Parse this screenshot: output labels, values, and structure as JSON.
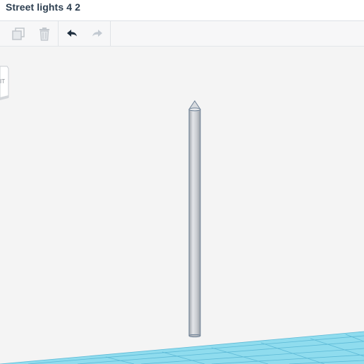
{
  "app": {
    "title": "Street lights 4 2"
  },
  "toolbar": {
    "buttons": [
      {
        "icon": "duplicate-icon",
        "enabled": false
      },
      {
        "icon": "trash-icon",
        "enabled": false
      },
      {
        "icon": "undo-icon",
        "enabled": true
      },
      {
        "icon": "redo-icon",
        "enabled": false
      }
    ]
  },
  "viewcube": {
    "face_label": "IT"
  },
  "colors": {
    "accent": "#7fd4e8",
    "grid_line": "#5bb8d4",
    "title_text": "#2c3e50",
    "pole_fill": "#c9ccd0",
    "pole_stroke": "#6d7f93"
  }
}
